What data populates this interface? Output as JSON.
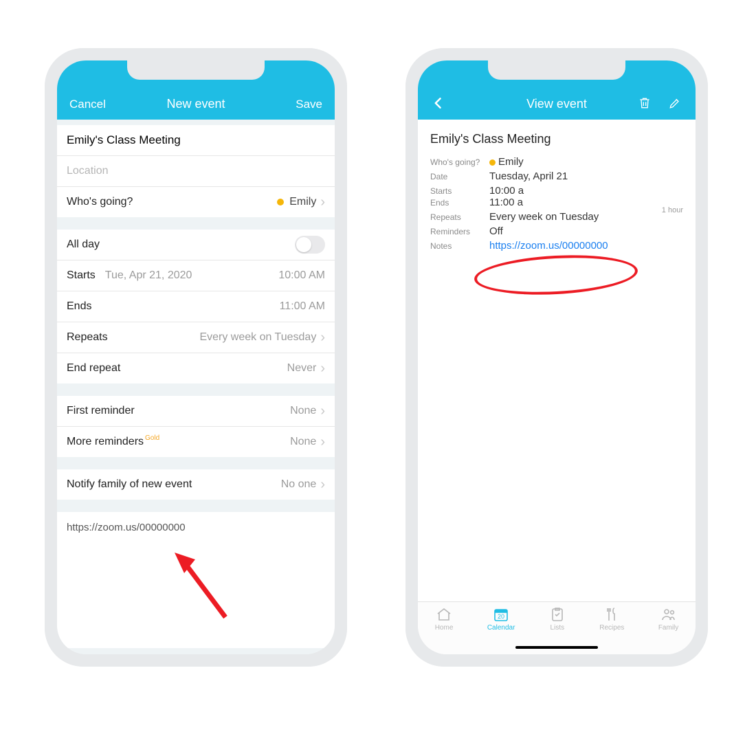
{
  "colors": {
    "accent": "#1fbde4",
    "link": "#1a7ff0",
    "annot": "#ec1c24",
    "gold": "#f5a623",
    "dot": "#f5b60a"
  },
  "left": {
    "header": {
      "cancel": "Cancel",
      "title": "New event",
      "save": "Save"
    },
    "event_title": "Emily's Class Meeting",
    "location_placeholder": "Location",
    "who_label": "Who's going?",
    "who_value": "Emily",
    "allday_label": "All day",
    "starts_label": "Starts",
    "starts_date": "Tue, Apr 21, 2020",
    "starts_time": "10:00 AM",
    "ends_label": "Ends",
    "ends_time": "11:00 AM",
    "repeats_label": "Repeats",
    "repeats_value": "Every week on Tuesday",
    "endrepeat_label": "End repeat",
    "endrepeat_value": "Never",
    "first_rem_label": "First reminder",
    "first_rem_value": "None",
    "more_rem_label": "More reminders",
    "more_rem_badge": "Gold",
    "more_rem_value": "None",
    "notify_label": "Notify family of new event",
    "notify_value": "No one",
    "notes_value": "https://zoom.us/00000000"
  },
  "right": {
    "header": {
      "title": "View event"
    },
    "title": "Emily's Class Meeting",
    "who_k": "Who's going?",
    "who_v": "Emily",
    "date_k": "Date",
    "date_v": "Tuesday, April 21",
    "starts_k": "Starts",
    "starts_v": "10:00 a",
    "ends_k": "Ends",
    "ends_v": "11:00 a",
    "duration": "1 hour",
    "repeats_k": "Repeats",
    "repeats_v": "Every week on Tuesday",
    "reminders_k": "Reminders",
    "reminders_v": "Off",
    "notes_k": "Notes",
    "notes_v": "https://zoom.us/00000000",
    "tabs": [
      "Home",
      "Calendar",
      "Lists",
      "Recipes",
      "Family"
    ],
    "calendar_day": "20"
  }
}
